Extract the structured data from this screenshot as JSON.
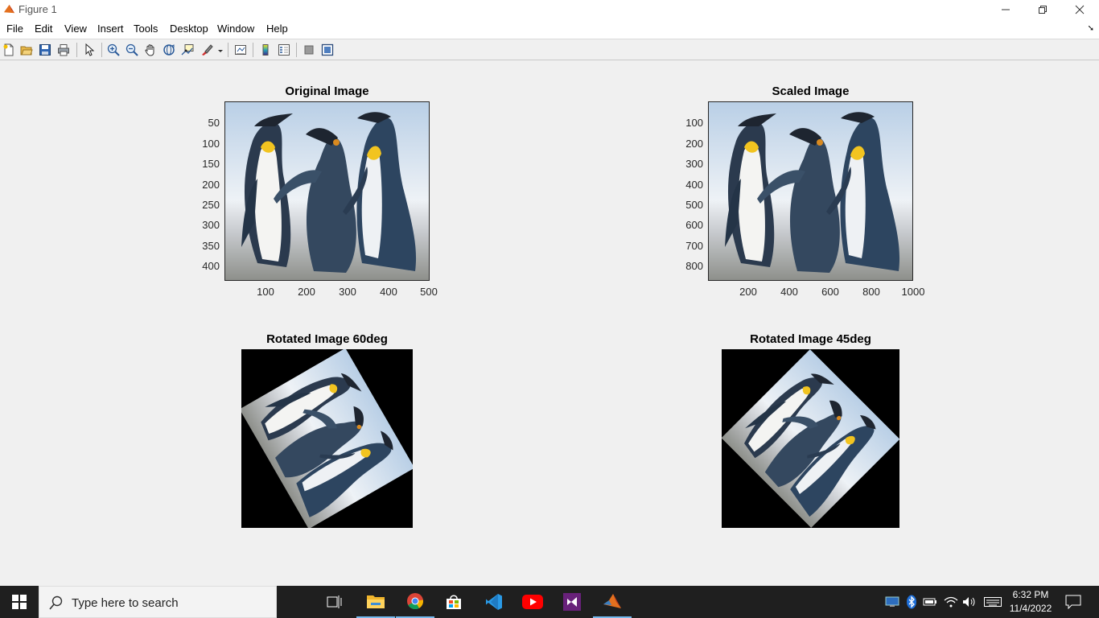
{
  "window": {
    "title": "Figure 1",
    "controls": {
      "minimize": "minimize",
      "maximize": "restore",
      "close": "close"
    }
  },
  "menu": [
    "File",
    "Edit",
    "View",
    "Insert",
    "Tools",
    "Desktop",
    "Window",
    "Help"
  ],
  "toolbar": {
    "icons": [
      "new-figure-icon",
      "open-icon",
      "save-icon",
      "print-icon",
      "select-pointer-icon",
      "zoom-in-icon",
      "zoom-out-icon",
      "pan-hand-icon",
      "rotate-3d-icon",
      "data-cursor-icon",
      "brush-icon",
      "link-plot-icon",
      "colorbar-icon",
      "legend-icon",
      "hide-plot-tools-icon",
      "show-plot-tools-icon"
    ]
  },
  "plots": {
    "original": {
      "title": "Original Image",
      "yticks": [
        "50",
        "100",
        "150",
        "200",
        "250",
        "300",
        "350",
        "400"
      ],
      "xticks": [
        "100",
        "200",
        "300",
        "400",
        "500"
      ]
    },
    "scaled": {
      "title": "Scaled Image",
      "yticks": [
        "100",
        "200",
        "300",
        "400",
        "500",
        "600",
        "700",
        "800"
      ],
      "xticks": [
        "200",
        "400",
        "600",
        "800",
        "1000"
      ]
    },
    "rot60": {
      "title": "Rotated Image 60deg"
    },
    "rot45": {
      "title": "Rotated Image 45deg"
    }
  },
  "taskbar": {
    "search_placeholder": "Type here to search",
    "apps": [
      "task-view-icon",
      "file-explorer-icon",
      "chrome-icon",
      "store-icon",
      "vscode-icon",
      "youtube-icon",
      "visual-studio-icon",
      "matlab-icon"
    ],
    "time": "6:32 PM",
    "date": "11/4/2022"
  }
}
